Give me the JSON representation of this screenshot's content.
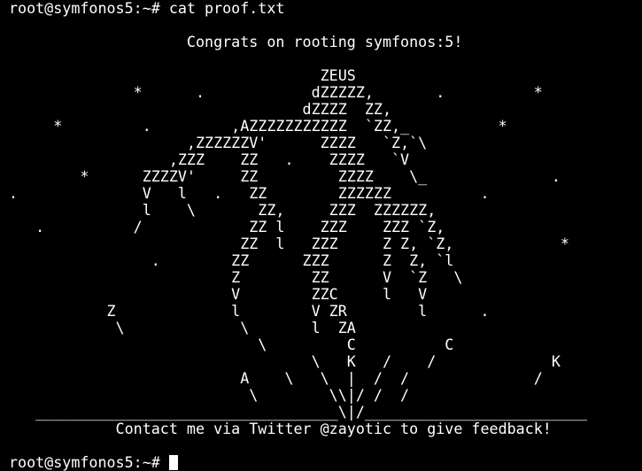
{
  "terminal": {
    "prompt": "root@symfonos5:~# ",
    "command": "cat proof.txt",
    "output_lines": [
      "",
      "                    Congrats on rooting symfonos:5!",
      "",
      "                                   ZEUS",
      "              *      .            dZZZZZ,       .          *",
      "                                 dZZZZ  ZZ,",
      "     *         .         ,AZZZZZZZZZZZ  `ZZ,_          *",
      "                    ,ZZZZZZV'      ZZZZ   `Z,`\\",
      "                  ,ZZZ    ZZ   .    ZZZZ   `V",
      "        *      ZZZZV'     ZZ         ZZZZ    \\_              .",
      ".              V   l   .   ZZ        ZZZZZZ          .",
      "               l    \\       ZZ,     ZZZ  ZZZZZZ,",
      "   .          /            ZZ l    ZZZ    ZZZ `Z,",
      "                          ZZ  l   ZZZ     Z Z, `Z,            *",
      "                .        ZZ      ZZZ      Z  Z, `l",
      "                         Z        ZZ      V  `Z   \\",
      "                         V        ZZC     l   V",
      "           Z             l        V ZR        l      .",
      "            \\             \\       l  ZA",
      "                            \\         C          C",
      "                                  \\   K   /    /             K",
      "                          A    \\   \\  |  /  /              /",
      "                           \\        \\\\|/ /  /",
      "   __________________________________\\|/_________________________",
      "            Contact me via Twitter @zayotic to give feedback!",
      ""
    ],
    "final_prompt": "root@symfonos5:~# "
  }
}
